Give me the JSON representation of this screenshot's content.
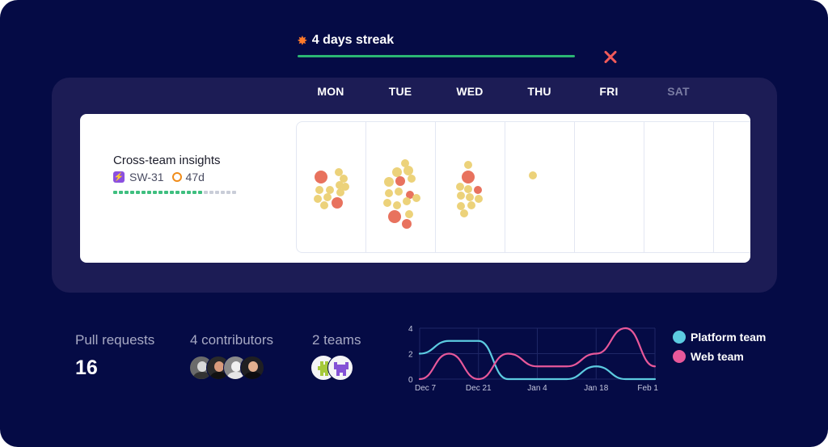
{
  "streak": {
    "icon": "explosion-icon",
    "label": "4 days streak",
    "streak_days": 4,
    "missed_day_icon": "x-icon",
    "colors": {
      "bar": "#2bb673",
      "missed": "#f05a5a"
    }
  },
  "week": {
    "days": [
      {
        "label": "MON",
        "dimmed": false
      },
      {
        "label": "TUE",
        "dimmed": false
      },
      {
        "label": "WED",
        "dimmed": false
      },
      {
        "label": "THU",
        "dimmed": false
      },
      {
        "label": "FRI",
        "dimmed": false
      },
      {
        "label": "SAT",
        "dimmed": true
      }
    ]
  },
  "issue": {
    "title": "Cross-team insights",
    "badge_icon": "lightning-icon",
    "key": "SW-31",
    "cycle_icon": "cycle-ring-icon",
    "age": "47d",
    "progress": {
      "done": 16,
      "total": 22
    }
  },
  "activity": {
    "legend_colors": {
      "small": "#ecd27a",
      "large": "#e8725e"
    },
    "days": [
      {
        "day": "MON",
        "yellow": 11,
        "red": 2
      },
      {
        "day": "TUE",
        "yellow": 12,
        "red": 4
      },
      {
        "day": "WED",
        "yellow": 10,
        "red": 2
      },
      {
        "day": "THU",
        "yellow": 1,
        "red": 0
      },
      {
        "day": "FRI",
        "yellow": 0,
        "red": 0
      },
      {
        "day": "SAT",
        "yellow": 0,
        "red": 0
      }
    ]
  },
  "stats": {
    "pull_requests_label": "Pull requests",
    "pull_requests_value": "16",
    "contributors_label": "4 contributors",
    "contributors": [
      "contributor-1",
      "contributor-2",
      "contributor-3",
      "contributor-4"
    ],
    "teams_label": "2 teams",
    "teams": [
      {
        "name": "Platform team",
        "color": "#a6c93a"
      },
      {
        "name": "Web team",
        "color": "#8452d6"
      }
    ]
  },
  "chart_data": {
    "type": "line",
    "title": "",
    "xlabel": "",
    "ylabel": "",
    "x": [
      "Dec 7",
      "Dec 14",
      "Dec 21",
      "Dec 28",
      "Jan 4",
      "Jan 11",
      "Jan 18",
      "Jan 25",
      "Feb 1"
    ],
    "x_ticks": [
      "Dec 7",
      "Dec 21",
      "Jan 4",
      "Jan 18",
      "Feb 1"
    ],
    "y_ticks": [
      "0",
      "2",
      "4"
    ],
    "ylim": [
      0,
      4
    ],
    "grid": true,
    "series": [
      {
        "name": "Platform team",
        "color": "#5ccbe0",
        "values": [
          2,
          3,
          3,
          0,
          0,
          0,
          1,
          0,
          0
        ]
      },
      {
        "name": "Web team",
        "color": "#e8589a",
        "values": [
          0,
          2,
          0,
          2,
          1,
          1,
          2,
          4,
          1
        ]
      }
    ],
    "legend": "right"
  }
}
